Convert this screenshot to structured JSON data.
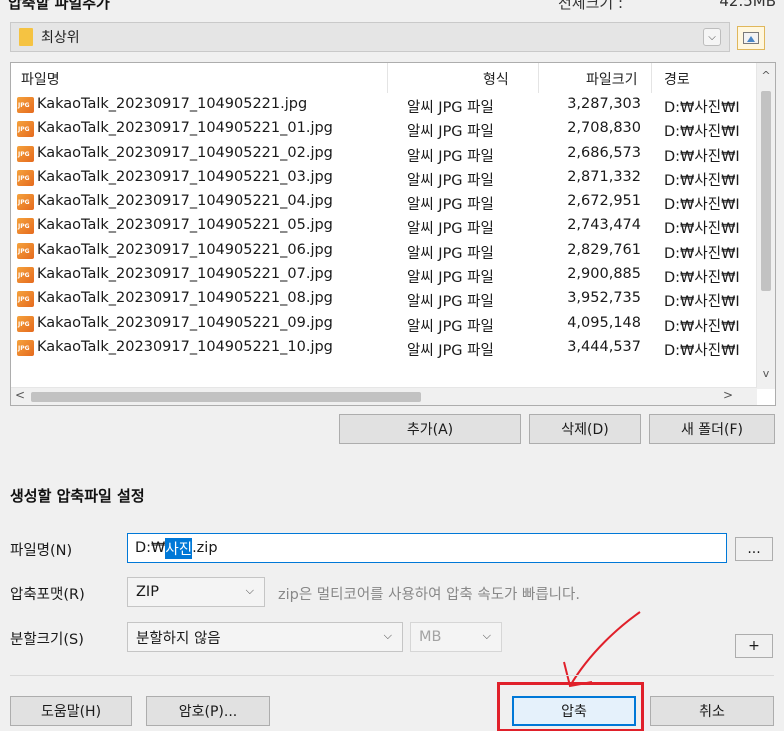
{
  "header": {
    "title": "압축할 파일추가",
    "total_label": "전체크기 :",
    "total_value": "42.5MB"
  },
  "folder": {
    "current": "최상위"
  },
  "file_list": {
    "columns": [
      "파일명",
      "형식",
      "파일크기",
      "경로"
    ],
    "rows": [
      {
        "name": "KakaoTalk_20230917_104905221.jpg",
        "type": "알씨 JPG 파일",
        "size": "3,287,303",
        "path": "D:₩사진₩I"
      },
      {
        "name": "KakaoTalk_20230917_104905221_01.jpg",
        "type": "알씨 JPG 파일",
        "size": "2,708,830",
        "path": "D:₩사진₩I"
      },
      {
        "name": "KakaoTalk_20230917_104905221_02.jpg",
        "type": "알씨 JPG 파일",
        "size": "2,686,573",
        "path": "D:₩사진₩I"
      },
      {
        "name": "KakaoTalk_20230917_104905221_03.jpg",
        "type": "알씨 JPG 파일",
        "size": "2,871,332",
        "path": "D:₩사진₩I"
      },
      {
        "name": "KakaoTalk_20230917_104905221_04.jpg",
        "type": "알씨 JPG 파일",
        "size": "2,672,951",
        "path": "D:₩사진₩I"
      },
      {
        "name": "KakaoTalk_20230917_104905221_05.jpg",
        "type": "알씨 JPG 파일",
        "size": "2,743,474",
        "path": "D:₩사진₩I"
      },
      {
        "name": "KakaoTalk_20230917_104905221_06.jpg",
        "type": "알씨 JPG 파일",
        "size": "2,829,761",
        "path": "D:₩사진₩I"
      },
      {
        "name": "KakaoTalk_20230917_104905221_07.jpg",
        "type": "알씨 JPG 파일",
        "size": "2,900,885",
        "path": "D:₩사진₩I"
      },
      {
        "name": "KakaoTalk_20230917_104905221_08.jpg",
        "type": "알씨 JPG 파일",
        "size": "3,952,735",
        "path": "D:₩사진₩I"
      },
      {
        "name": "KakaoTalk_20230917_104905221_09.jpg",
        "type": "알씨 JPG 파일",
        "size": "4,095,148",
        "path": "D:₩사진₩I"
      },
      {
        "name": "KakaoTalk_20230917_104905221_10.jpg",
        "type": "알씨 JPG 파일",
        "size": "3,444,537",
        "path": "D:₩사진₩I"
      }
    ]
  },
  "list_buttons": {
    "add": "추가(A)",
    "delete": "삭제(D)",
    "new_folder": "새 폴더(F)"
  },
  "settings": {
    "section_title": "생성할 압축파일 설정",
    "filename_label": "파일명(N)",
    "filename_prefix": "D:₩",
    "filename_selected": "사진",
    "filename_suffix": ".zip",
    "browse_label": "...",
    "format_label": "압축포맷(R)",
    "format_value": "ZIP",
    "format_hint": "zip은 멀티코어를 사용하여 압축 속도가 빠릅니다.",
    "split_label": "분할크기(S)",
    "split_value": "분할하지 않음",
    "split_unit": "MB",
    "plus_label": "+"
  },
  "footer": {
    "help": "도움말(H)",
    "password": "암호(P)...",
    "compress": "압축",
    "cancel": "취소"
  },
  "colors": {
    "accent": "#0078d7",
    "annotation": "#e0202a"
  }
}
